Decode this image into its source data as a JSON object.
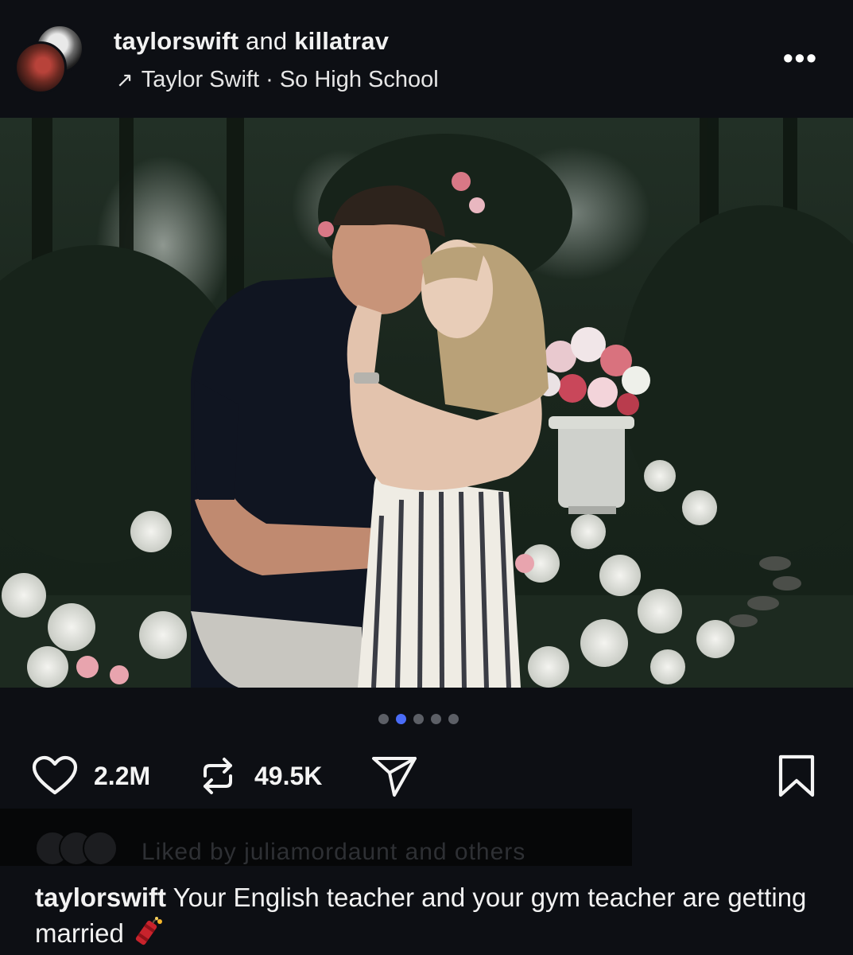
{
  "header": {
    "user1": "taylorswift",
    "joiner": " and ",
    "user2": "killatrav",
    "music_arrow": "↗",
    "music_label": "Taylor Swift · So High School",
    "more_label": "•••"
  },
  "carousel": {
    "count": 5,
    "active_index": 1
  },
  "actions": {
    "likes": "2.2M",
    "reposts": "49.5K"
  },
  "liked_by": {
    "text": "Liked by juliamordaunt and others"
  },
  "caption": {
    "user": "taylorswift",
    "text": "Your English teacher and your gym teacher are getting married"
  },
  "colors": {
    "background": "#0d0f14",
    "active_dot": "#4a6cf7",
    "inactive_dot": "#5c5f66"
  }
}
